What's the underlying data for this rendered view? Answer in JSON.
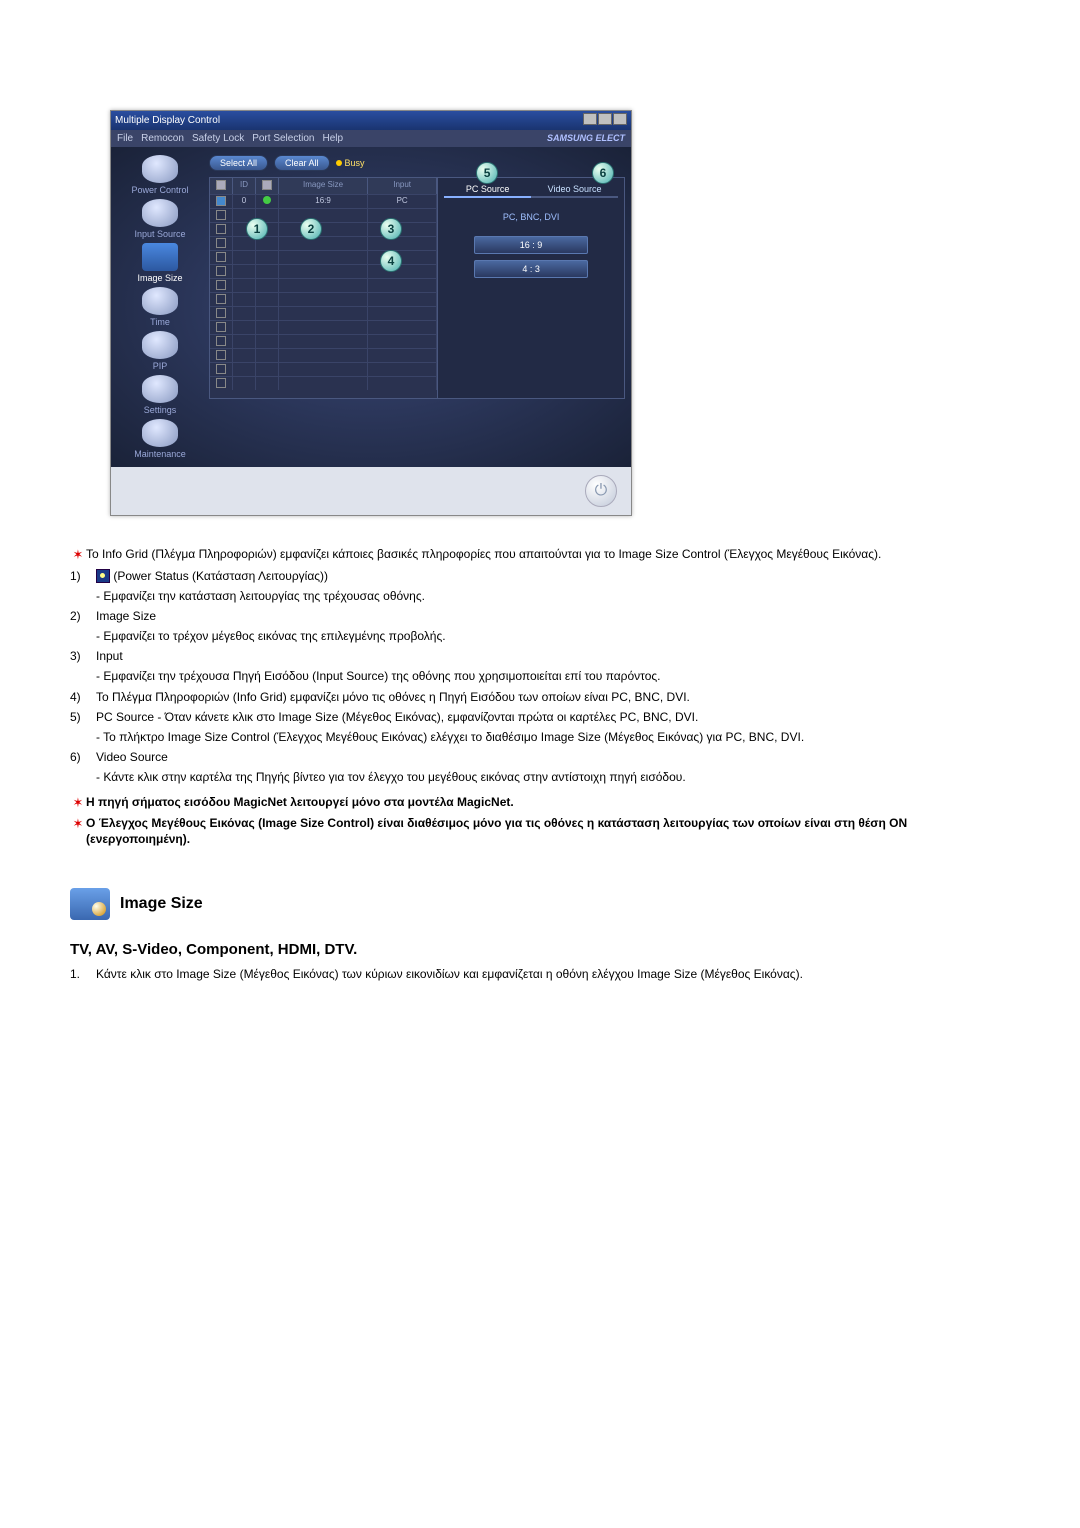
{
  "app": {
    "title": "Multiple Display Control",
    "menus": [
      "File",
      "Remocon",
      "Safety Lock",
      "Port Selection",
      "Help"
    ],
    "brand": "SAMSUNG ELECT",
    "sidebar": [
      {
        "label": "Power Control"
      },
      {
        "label": "Input Source"
      },
      {
        "label": "Image Size"
      },
      {
        "label": "Time"
      },
      {
        "label": "PIP"
      },
      {
        "label": "Settings"
      },
      {
        "label": "Maintenance"
      }
    ],
    "toolbar": {
      "select_all": "Select All",
      "clear_all": "Clear All",
      "busy": "Busy"
    },
    "grid": {
      "headers": {
        "c4": "Image Size",
        "c5": "Input"
      },
      "row0": {
        "c4": "16:9",
        "c5": "PC"
      }
    },
    "right": {
      "tab1": "PC Source",
      "tab2": "Video Source",
      "sub": "PC, BNC, DVI",
      "opt1": "16 : 9",
      "opt2": "4 : 3"
    },
    "markers": {
      "m1": "1",
      "m2": "2",
      "m3": "3",
      "m4": "4",
      "m5": "5",
      "m6": "6"
    }
  },
  "doc": {
    "intro": "Το Info Grid (Πλέγμα Πληροφοριών) εμφανίζει κάποιες βασικές πληροφορίες που απαιτούνται για το Image Size Control (Έλεγχος Μεγέθους Εικόνας).",
    "i1_num": "1)",
    "i1_title": "(Power Status (Κατάσταση Λειτουργίας))",
    "i1_sub": "- Εμφανίζει την κατάσταση λειτουργίας της τρέχουσας οθόνης.",
    "i2_num": "2)",
    "i2_title": "Image Size",
    "i2_sub": "- Εμφανίζει το τρέχον μέγεθος εικόνας της επιλεγμένης προβολής.",
    "i3_num": "3)",
    "i3_title": "Input",
    "i3_sub": "- Εμφανίζει την τρέχουσα Πηγή Εισόδου (Input Source) της οθόνης που χρησιμοποιείται επί του παρόντος.",
    "i4_num": "4)",
    "i4_title": "Το Πλέγμα Πληροφοριών (Info Grid) εμφανίζει μόνο τις οθόνες η Πηγή Εισόδου των οποίων είναι PC, BNC, DVI.",
    "i5_num": "5)",
    "i5_title": "PC Source - Όταν κάνετε κλικ στο Image Size (Μέγεθος Εικόνας), εμφανίζονται πρώτα οι καρτέλες PC, BNC, DVI.",
    "i5_sub": "- Το πλήκτρο Image Size Control (Έλεγχος Μεγέθους Εικόνας) ελέγχει το διαθέσιμο Image Size (Μέγεθος Εικόνας) για PC, BNC, DVI.",
    "i6_num": "6)",
    "i6_title": "Video Source",
    "i6_sub": "- Κάντε κλικ στην καρτέλα της Πηγής βίντεο για τον έλεγχο του μεγέθους εικόνας στην αντίστοιχη πηγή εισόδου.",
    "note1": "Η πηγή σήματος εισόδου MagicNet λειτουργεί μόνο στα μοντέλα MagicNet.",
    "note2": "Ο Έλεγχος Μεγέθους Εικόνας (Image Size Control) είναι διαθέσιμος μόνο για τις οθόνες η κατάσταση λειτουργίας των οποίων είναι στη θέση ON (ενεργοποιημένη).",
    "section_title": "Image Size",
    "subsection": "TV, AV, S-Video, Component, HDMI, DTV.",
    "step1_num": "1.",
    "step1": "Κάντε κλικ στο Image Size (Μέγεθος Εικόνας) των κύριων εικονιδίων και εμφανίζεται η οθόνη ελέγχου Image Size (Μέγεθος Εικόνας)."
  }
}
